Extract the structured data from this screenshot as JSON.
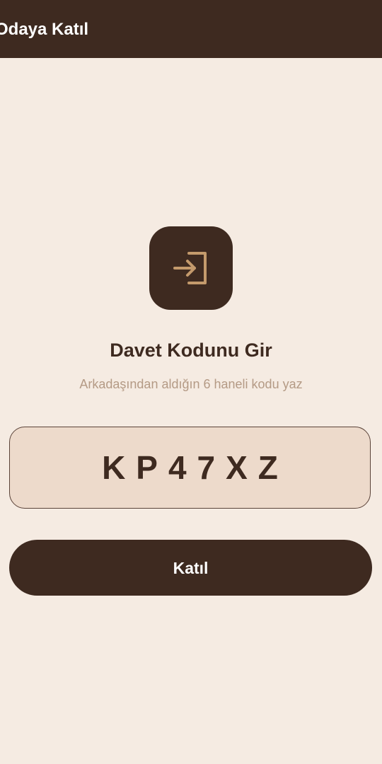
{
  "app_bar": {
    "title": "Odaya Katıl"
  },
  "hero": {
    "icon": "login-arrow-icon",
    "icon_color": "#c49a6c",
    "heading": "Davet Kodunu Gir",
    "subtitle": "Arkadaşından aldığın 6 haneli kodu yaz"
  },
  "code_input": {
    "value": "KP47XZ"
  },
  "join_button": {
    "label": "Katıl"
  },
  "colors": {
    "primary_dark": "#3e2a20",
    "background": "#f5ebe2",
    "field_fill": "#eddacb",
    "accent": "#c49a6c",
    "muted_text": "#b49a85"
  }
}
